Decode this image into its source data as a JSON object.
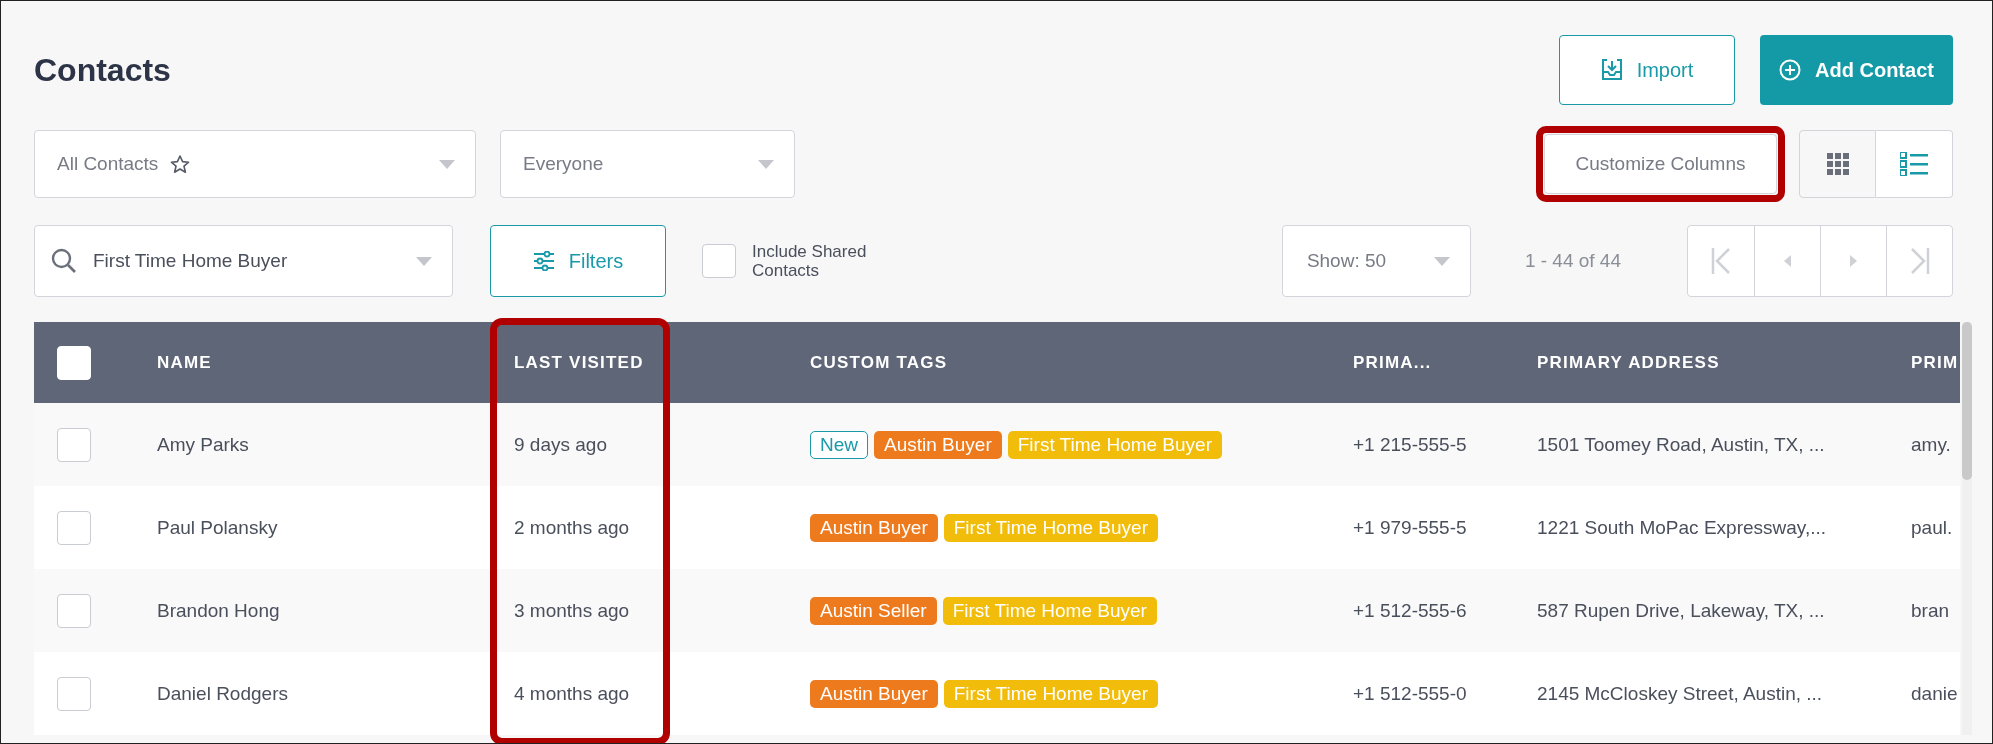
{
  "page": {
    "title": "Contacts"
  },
  "actions": [
    {
      "kind": "import",
      "label": "Import"
    },
    {
      "kind": "add",
      "label": "Add Contact"
    }
  ],
  "list_dropdown": {
    "value": "All Contacts"
  },
  "owner_dropdown": {
    "value": "Everyone"
  },
  "customize_columns": {
    "label": "Customize Columns",
    "highlighted": true
  },
  "view_toggle": [
    {
      "kind": "grid",
      "selected": false
    },
    {
      "kind": "list",
      "selected": true
    }
  ],
  "search": {
    "value": "First Time Home Buyer"
  },
  "filters_button": {
    "label": "Filters"
  },
  "include_shared": {
    "label": "Include Shared Contacts",
    "checked": false
  },
  "page_size": {
    "value": "Show: 50"
  },
  "range": "1 - 44 of 44",
  "pager": [
    {
      "kind": "first",
      "disabled": true
    },
    {
      "kind": "prev",
      "disabled": true
    },
    {
      "kind": "next",
      "disabled": true
    },
    {
      "kind": "last",
      "disabled": true
    }
  ],
  "table": {
    "select_all_checked": false,
    "columns": [
      {
        "label": "NAME",
        "highlighted": false
      },
      {
        "label": "LAST VISITED",
        "highlighted": true
      },
      {
        "label": "CUSTOM TAGS",
        "highlighted": false
      },
      {
        "label": "PRIMA...",
        "highlighted": false
      },
      {
        "label": "PRIMARY ADDRESS",
        "highlighted": false
      },
      {
        "label": "PRIM",
        "highlighted": false
      }
    ],
    "rows": [
      {
        "checked": false,
        "name": "Amy Parks",
        "last_visited": "9 days ago",
        "tags": [
          {
            "label": "New",
            "kind": "outline",
            "color": "#1a9aa8"
          },
          {
            "label": "Austin Buyer",
            "kind": "solid",
            "color": "#ee7a1e"
          },
          {
            "label": "First Time Home Buyer",
            "kind": "solid",
            "color": "#f2bd0a"
          }
        ],
        "phone": "+1 215-555-5",
        "address": "1501 Toomey Road, Austin, TX, ...",
        "email": "amy."
      },
      {
        "checked": false,
        "name": "Paul Polansky",
        "last_visited": "2 months ago",
        "tags": [
          {
            "label": "Austin Buyer",
            "kind": "solid",
            "color": "#ee7a1e"
          },
          {
            "label": "First Time Home Buyer",
            "kind": "solid",
            "color": "#f2bd0a"
          }
        ],
        "phone": "+1 979-555-5",
        "address": "1221 South MoPac Expressway,...",
        "email": "paul."
      },
      {
        "checked": false,
        "name": "Brandon Hong",
        "last_visited": "3 months ago",
        "tags": [
          {
            "label": "Austin Seller",
            "kind": "solid",
            "color": "#ee7a1e"
          },
          {
            "label": "First Time Home Buyer",
            "kind": "solid",
            "color": "#f2bd0a"
          }
        ],
        "phone": "+1 512-555-6",
        "address": "587 Rupen Drive, Lakeway, TX, ...",
        "email": "bran"
      },
      {
        "checked": false,
        "name": "Daniel Rodgers",
        "last_visited": "4 months ago",
        "tags": [
          {
            "label": "Austin Buyer",
            "kind": "solid",
            "color": "#ee7a1e"
          },
          {
            "label": "First Time Home Buyer",
            "kind": "solid",
            "color": "#f2bd0a"
          }
        ],
        "phone": "+1 512-555-0",
        "address": "2145 McCloskey Street, Austin, ...",
        "email": "danie"
      }
    ]
  }
}
